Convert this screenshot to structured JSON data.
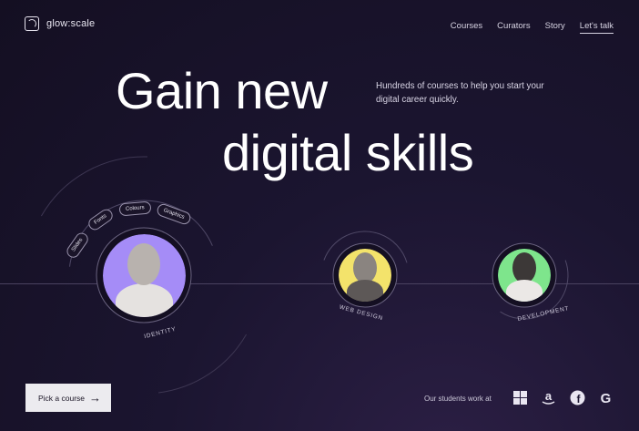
{
  "brand": {
    "name": "glow:scale"
  },
  "nav": {
    "items": [
      "Courses",
      "Curators",
      "Story",
      "Let's talk"
    ]
  },
  "hero": {
    "title_line1": "Gain new",
    "title_line2": "digital skills",
    "subtitle": "Hundreds of courses to help you start your digital career quickly."
  },
  "topics": [
    "Slides",
    "Fonts",
    "Colours",
    "Graphics"
  ],
  "curators": [
    {
      "caption": "IDENTITY",
      "accent": "#a58cf7"
    },
    {
      "caption": "WEB DESIGN",
      "accent": "#f3e36b"
    },
    {
      "caption": "DEVELOPMENT",
      "accent": "#7ee58c"
    }
  ],
  "cta": {
    "label": "Pick a course",
    "icon": "arrow-right-icon"
  },
  "footer": {
    "students_text": "Our students work at",
    "logos": [
      "windows-icon",
      "amazon-icon",
      "facebook-icon",
      "google-icon"
    ]
  },
  "colors": {
    "background": "#1b1530",
    "text": "#ffffff",
    "button_bg": "#ecebef"
  }
}
